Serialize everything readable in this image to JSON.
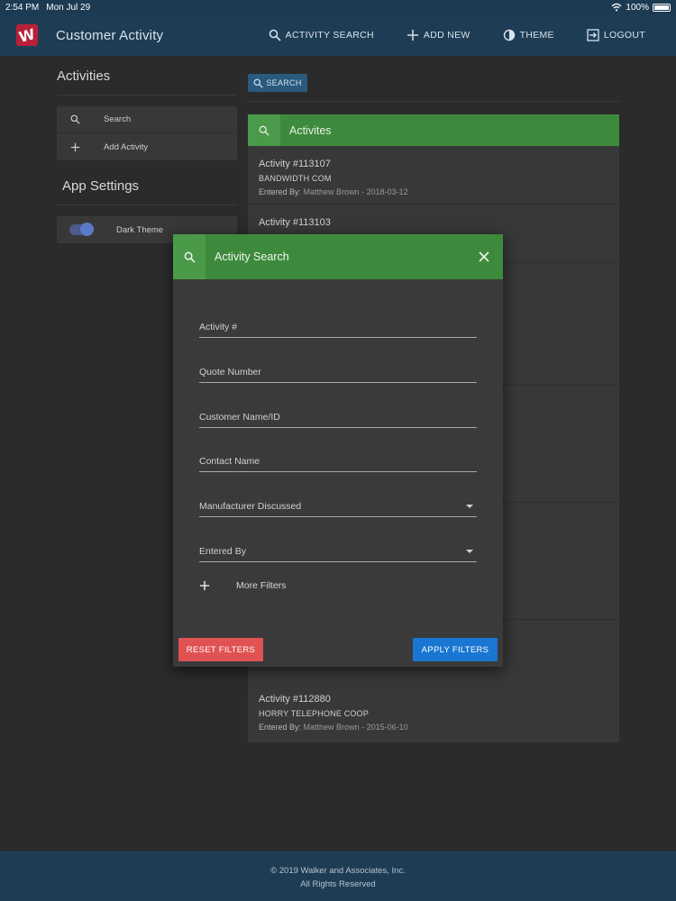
{
  "status_bar": {
    "time": "2:54 PM",
    "date": "Mon Jul 29",
    "battery": "100%"
  },
  "header": {
    "title": "Customer Activity",
    "nav": [
      {
        "label": "ACTIVITY SEARCH",
        "icon": "search-icon"
      },
      {
        "label": "ADD NEW",
        "icon": "plus-icon"
      },
      {
        "label": "THEME",
        "icon": "theme-icon"
      },
      {
        "label": "LOGOUT",
        "icon": "logout-icon"
      }
    ]
  },
  "sidebar": {
    "heading": "Activities",
    "items": [
      {
        "label": "Search",
        "icon": "search-icon"
      },
      {
        "label": "Add Activity",
        "icon": "plus-icon"
      }
    ],
    "settings_heading": "App Settings",
    "dark_theme_label": "Dark Theme",
    "dark_theme_on": true
  },
  "main": {
    "search_button": "SEARCH",
    "list_title": "Activites",
    "activities": [
      {
        "number": "Activity #113107",
        "customer": "BANDWIDTH COM",
        "entered_by_label": "Entered By:",
        "entered_by": "Matthew Brown - 2018-03-12"
      },
      {
        "number": "Activity #113103",
        "customer": "",
        "entered_by_label": "",
        "entered_by": ""
      },
      {
        "number": "Activity #112880",
        "customer": "HORRY TELEPHONE COOP",
        "entered_by_label": "Entered By:",
        "entered_by": "Matthew Brown - 2015-06-10"
      }
    ]
  },
  "modal": {
    "title": "Activity Search",
    "fields": [
      {
        "label": "Activity #",
        "type": "text"
      },
      {
        "label": "Quote Number",
        "type": "text"
      },
      {
        "label": "Customer Name/ID",
        "type": "text"
      },
      {
        "label": "Contact Name",
        "type": "text"
      },
      {
        "label": "Manufacturer Discussed",
        "type": "select"
      },
      {
        "label": "Entered By",
        "type": "select"
      }
    ],
    "more_filters": "More Filters",
    "reset_button": "RESET FILTERS",
    "apply_button": "APPLY FILTERS"
  },
  "footer": {
    "copyright": "© 2019 Walker and Associates, Inc.",
    "rights": "All Rights Reserved"
  },
  "colors": {
    "appbar": "#1e3d55",
    "accent_green": "#3e8a3d",
    "reset": "#e05252",
    "apply": "#1976d2"
  }
}
